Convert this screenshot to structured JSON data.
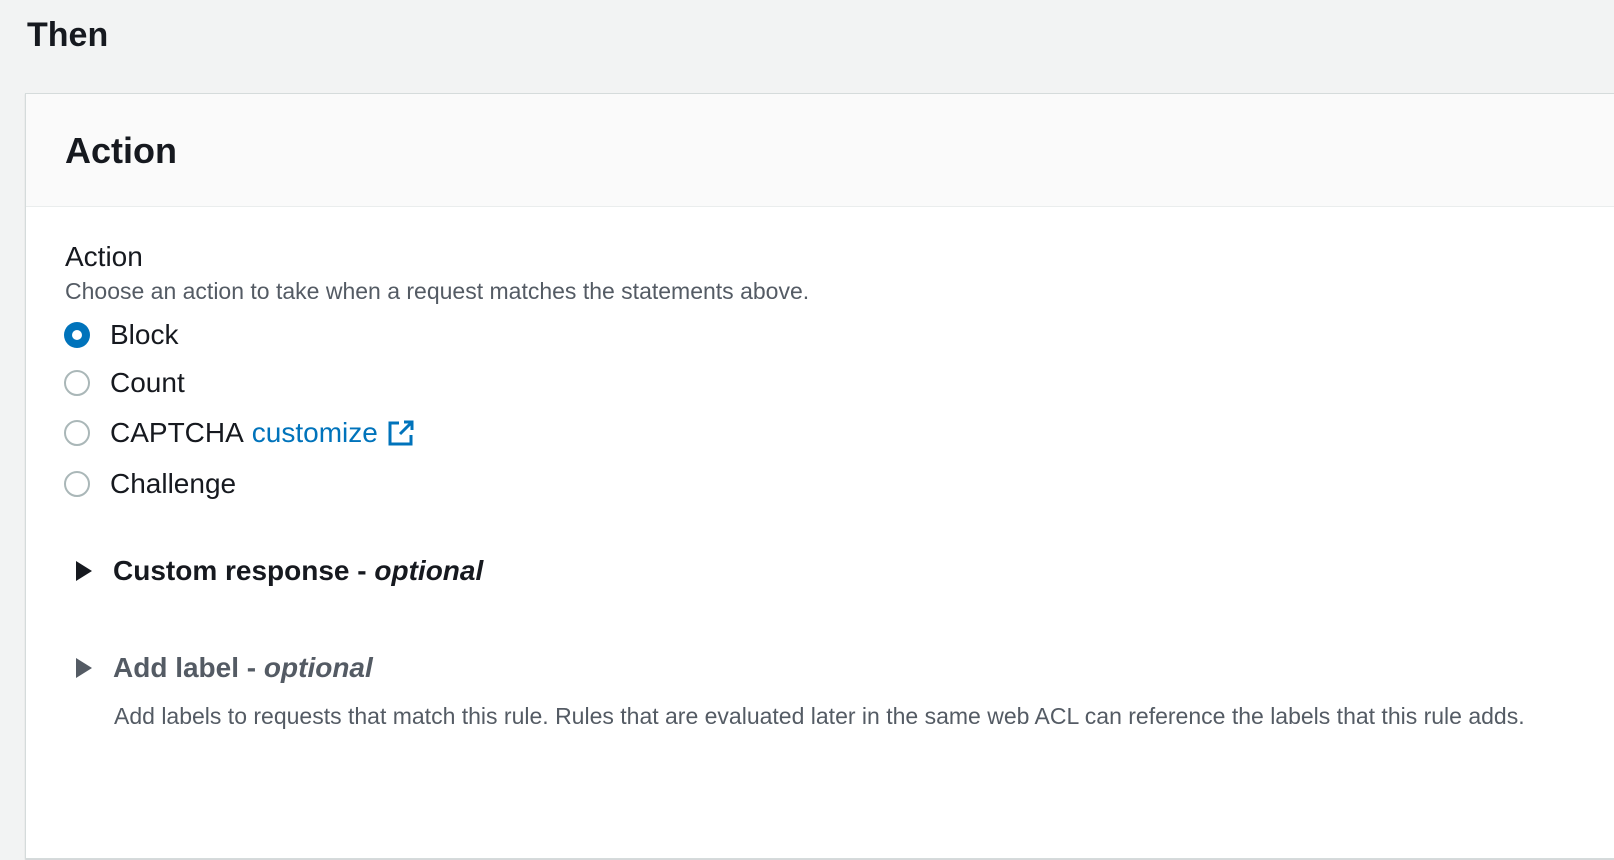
{
  "section": {
    "title": "Then"
  },
  "panel": {
    "title": "Action"
  },
  "action_field": {
    "label": "Action",
    "description": "Choose an action to take when a request matches the statements above.",
    "selected": "Block",
    "options": [
      {
        "label": "Block",
        "checked": true
      },
      {
        "label": "Count",
        "checked": false
      },
      {
        "label": "CAPTCHA",
        "checked": false,
        "link": "customize",
        "link_icon": "external-link-icon"
      },
      {
        "label": "Challenge",
        "checked": false
      }
    ]
  },
  "custom_response": {
    "title": "Custom response - ",
    "optional": "optional",
    "icon": "caret-right-icon"
  },
  "add_label": {
    "title": "Add label - ",
    "optional": "optional",
    "icon": "caret-right-icon",
    "description": "Add labels to requests that match this rule. Rules that are evaluated later in the same web ACL can reference the labels that this rule adds."
  },
  "colors": {
    "accent": "#0073bb",
    "text": "#16191f",
    "secondary_text": "#545b64",
    "page_background": "#f2f3f3",
    "panel_header_background": "#fafafa"
  }
}
